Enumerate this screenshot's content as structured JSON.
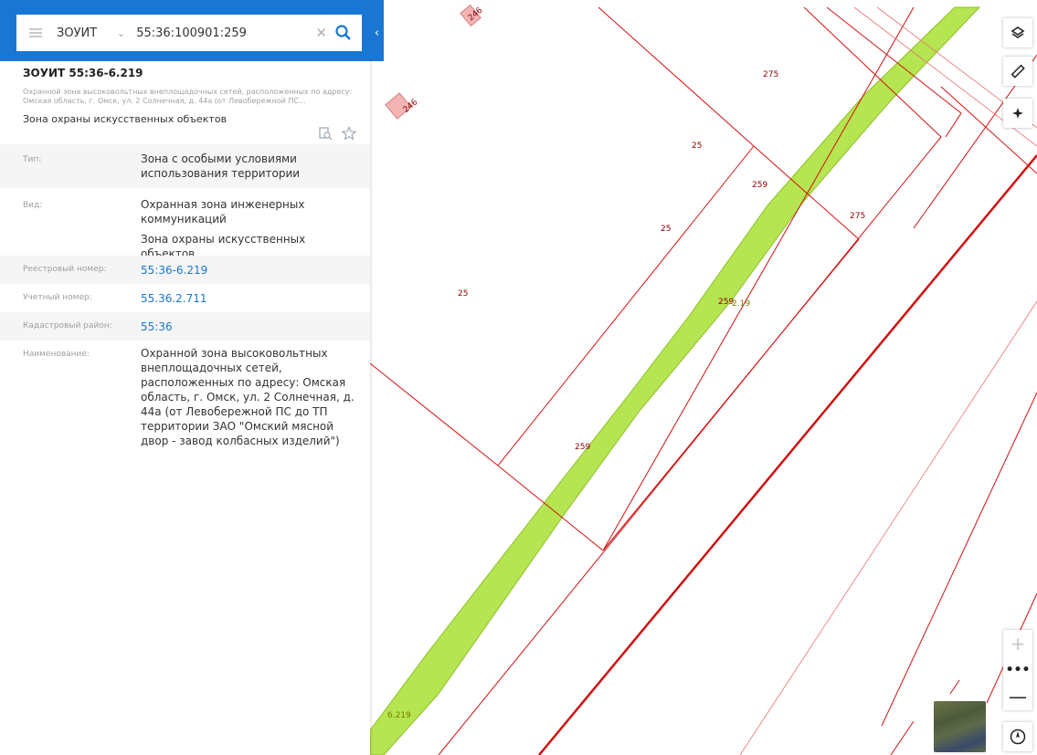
{
  "search": {
    "layer": "ЗОУИТ",
    "query": "55:36:100901:259"
  },
  "object": {
    "title": "ЗОУИТ 55:36-6.219",
    "description": "Охранной зона высоковольтных внеплощадочных сетей, расположенных по адресу: Омская область, г. Омск, ул. 2 Солнечная, д. 44а (от Левобережной ПС...",
    "type_line": "Зона охраны искусственных объектов"
  },
  "attributes": [
    {
      "key": "Тип:",
      "value": "Зона с особыми условиями использования территории"
    },
    {
      "key": "Вид:",
      "value": "Охранная зона инженерных коммуникаций",
      "value2": "Зона охраны искусственных объектов"
    },
    {
      "key": "Реестровый номер:",
      "value": "55:36-6.219"
    },
    {
      "key": "Учетный номер:",
      "value": "55.36.2.711"
    },
    {
      "key": "Кадастровый район:",
      "value": "55:36"
    },
    {
      "key": "Наименование:",
      "value": "Охранной зона высоковольтных внеплощадочных сетей, расположенных по адресу: Омская область, г. Омск, ул. 2 Солнечная, д. 44а (от Левобережной ПС до ТП территории ЗАО \"Омский мясной двор - завод колбасных изделий\")"
    }
  ],
  "map": {
    "labels": {
      "l275a": "275",
      "l275b": "275",
      "l25a": "25",
      "l25b": "25",
      "l25c": "25",
      "l259a": "259",
      "l259b": "259",
      "l259c": "259",
      "l246": "246",
      "l246b": "246",
      "z219": "2.19",
      "z6219": "6.219"
    }
  },
  "colors": {
    "accent": "#1976d2",
    "parcel_line": "#d01010",
    "zone_fill": "#b5e550"
  }
}
